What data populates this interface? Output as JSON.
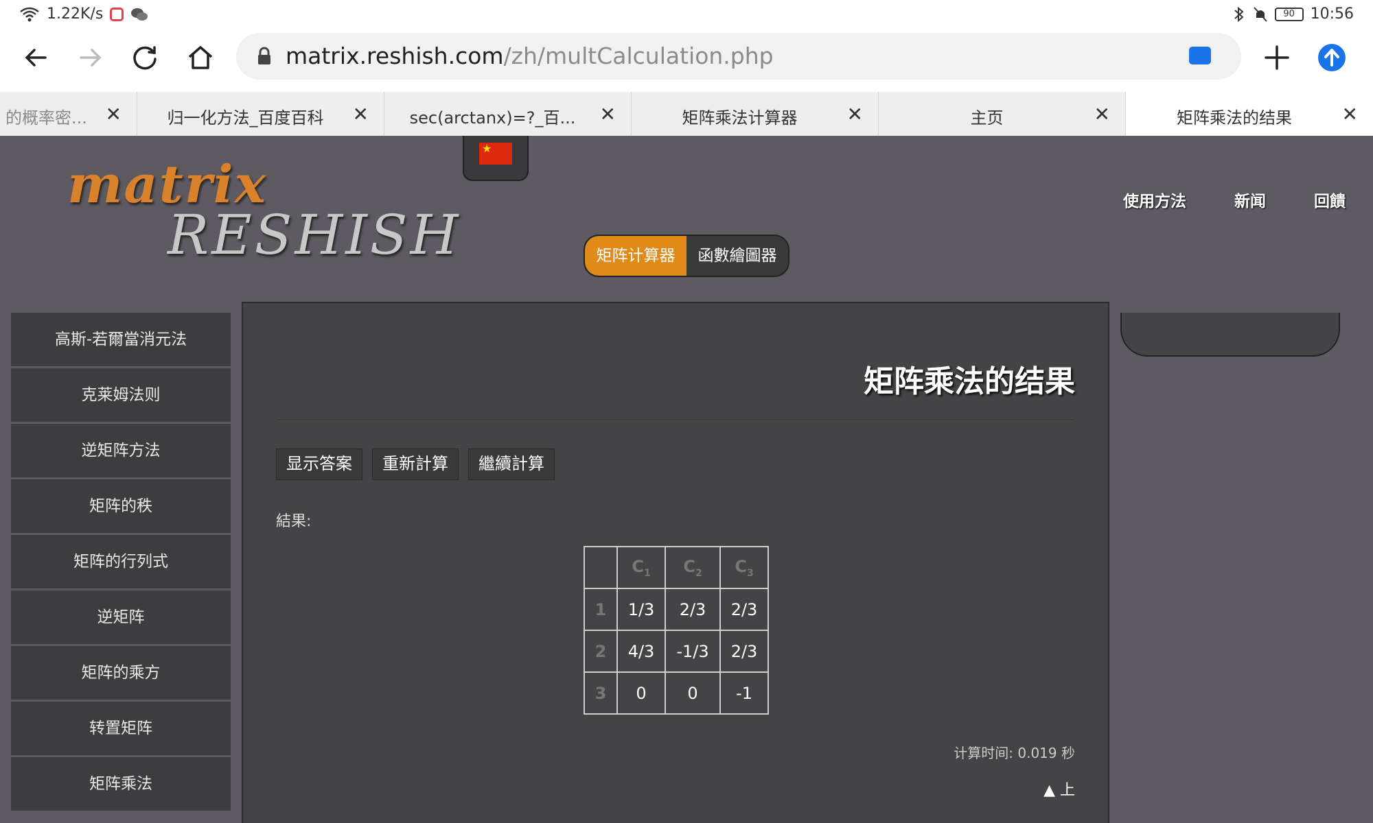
{
  "status_bar": {
    "network_speed": "1.22K/s",
    "battery": "90",
    "time": "10:56"
  },
  "browser": {
    "url_domain": "matrix.reshish.com",
    "url_path": "/zh/multCalculation.php",
    "tabs": [
      {
        "label": "的概率密..."
      },
      {
        "label": "归一化方法_百度百科"
      },
      {
        "label": "sec(arctanx)=?_百..."
      },
      {
        "label": "矩阵乘法计算器"
      },
      {
        "label": "主页"
      },
      {
        "label": "矩阵乘法的结果"
      }
    ],
    "tab_close_glyph": "✕"
  },
  "site": {
    "logo_top": "matrix",
    "logo_bottom": "RESHISH",
    "top_nav": [
      "使用方法",
      "新闻",
      "回饋"
    ],
    "switcher": {
      "active": "矩阵计算器",
      "inactive": "函數繪圖器"
    }
  },
  "sidebar": {
    "items": [
      "高斯-若爾當消元法",
      "克莱姆法则",
      "逆矩阵方法",
      "矩阵的秩",
      "矩阵的行列式",
      "逆矩阵",
      "矩阵的乘方",
      "转置矩阵",
      "矩阵乘法"
    ]
  },
  "main": {
    "title": "矩阵乘法的结果",
    "buttons": [
      "显示答案",
      "重新計算",
      "繼續計算"
    ],
    "result_label": "結果:",
    "table": {
      "column_prefix": "C",
      "columns": [
        "1",
        "2",
        "3"
      ],
      "rows": [
        {
          "index": "1",
          "cells": [
            "1/3",
            "2/3",
            "2/3"
          ]
        },
        {
          "index": "2",
          "cells": [
            "4/3",
            "-1/3",
            "2/3"
          ]
        },
        {
          "index": "3",
          "cells": [
            "0",
            "0",
            "-1"
          ]
        }
      ]
    },
    "calc_time": "计算时间: 0.019 秒",
    "back_to_top": "▲ 上"
  }
}
